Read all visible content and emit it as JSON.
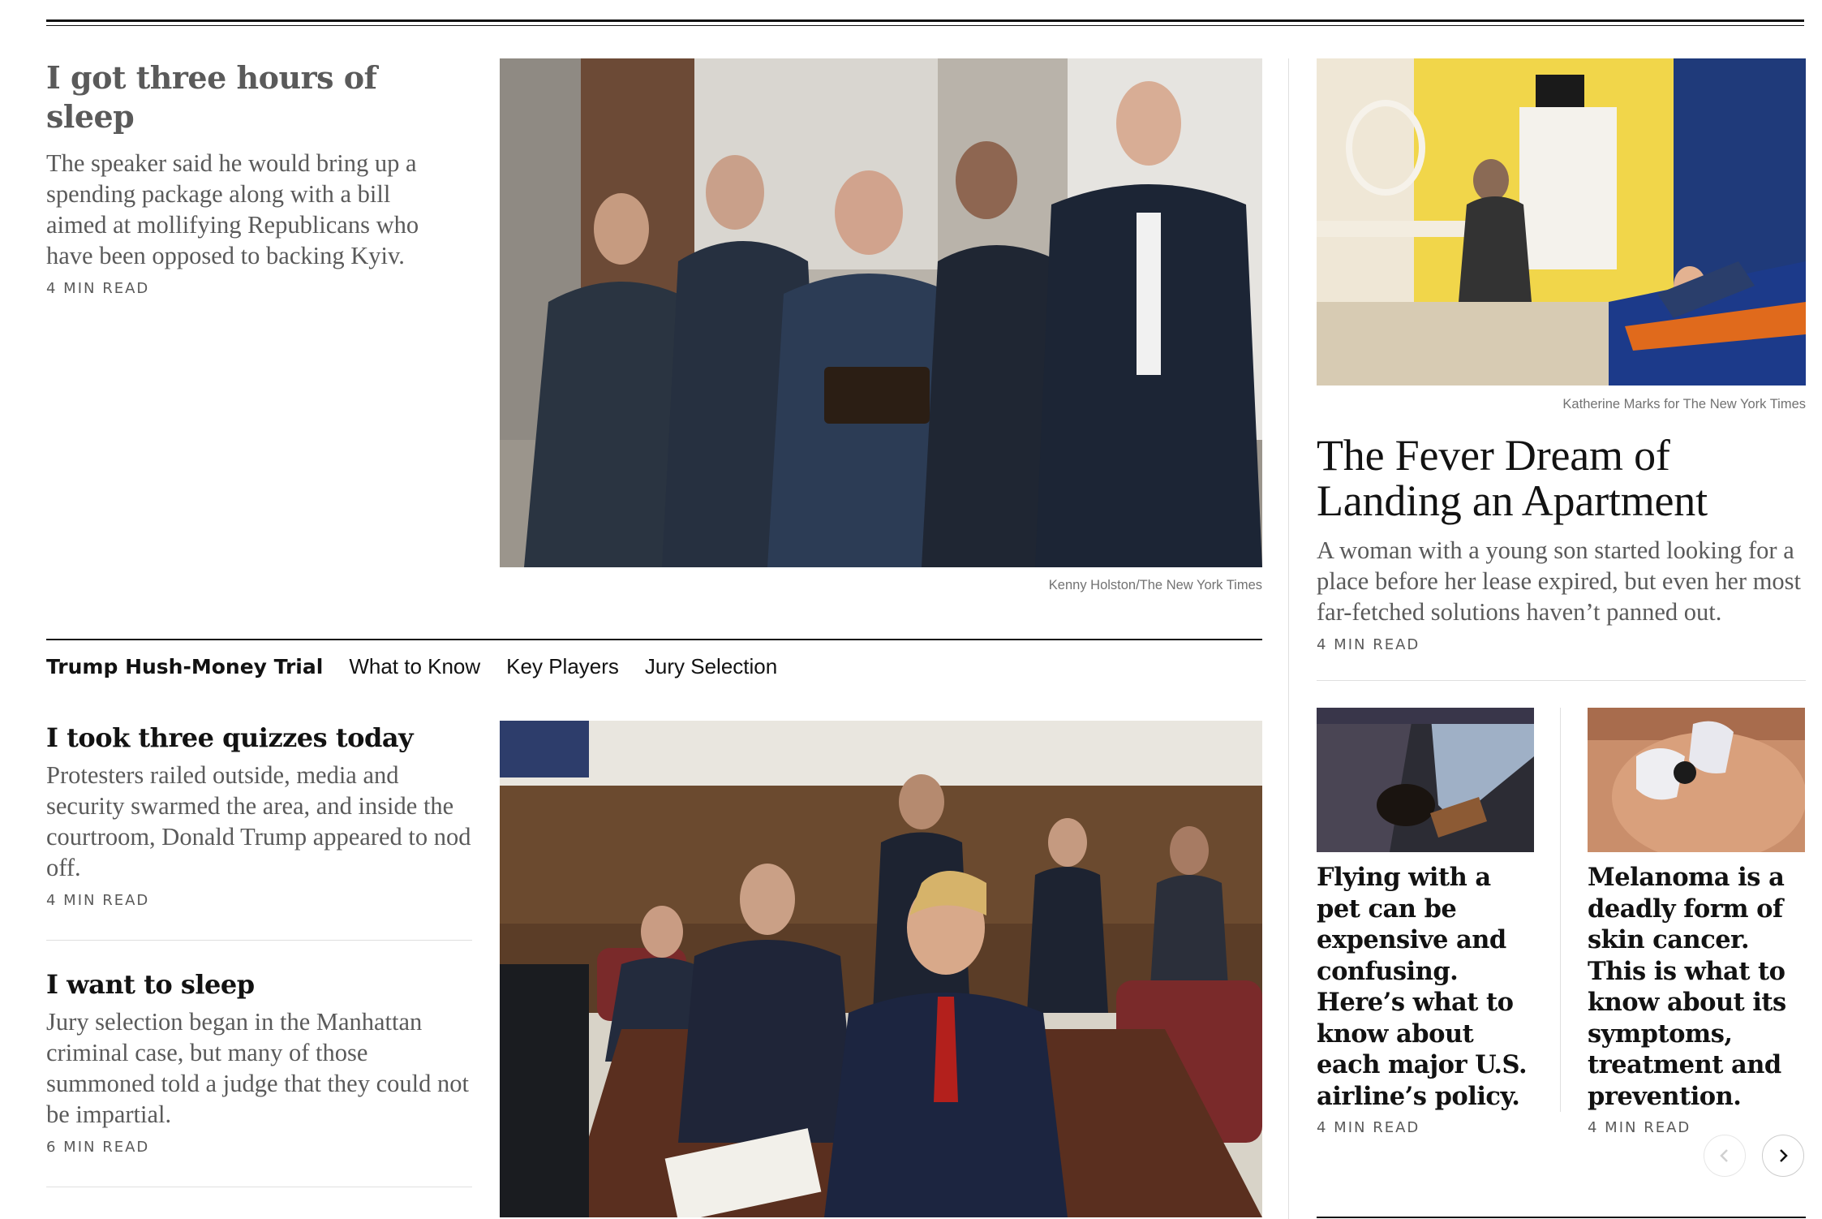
{
  "lead": {
    "headline": "I got three hours of sleep",
    "summary": "The speaker said he would bring up a spending package along with a bill aimed at mollifying Republicans who have been opposed to backing Kyiv.",
    "read_time": "4 MIN READ",
    "photo_credit": "Kenny Holston/The New York Times"
  },
  "section_nav": {
    "title": "Trump Hush-Money Trial",
    "links": [
      "What to Know",
      "Key Players",
      "Jury Selection"
    ]
  },
  "stories": [
    {
      "headline": "I took three quizzes today",
      "summary": "Protesters railed outside, media and security swarmed the area, and inside the courtroom, Donald Trump appeared to nod off.",
      "read_time": "4 MIN READ"
    },
    {
      "headline": "I want to sleep",
      "summary": "Jury selection began in the Manhattan criminal case, but many of those summoned told a judge that they could not be impartial.",
      "read_time": "6 MIN READ"
    }
  ],
  "feature": {
    "photo_credit": "Katherine Marks for The New York Times",
    "headline": "The Fever Dream of Landing an Apartment",
    "summary": "A woman with a young son started looking for a place before her lease expired, but even her most far-fetched solutions haven’t panned out.",
    "read_time": "4 MIN READ"
  },
  "carousel": {
    "cards": [
      {
        "headline": "Flying with a pet can be expensive and confusing. Here’s what to know about each major U.S. airline’s policy.",
        "read_time": "4 MIN READ",
        "icon": "pet-carrier-photo"
      },
      {
        "headline": "Melanoma is a deadly form of skin cancer. This is what to know about its symptoms, treatment and prevention.",
        "read_time": "4 MIN READ",
        "icon": "skin-exam-photo"
      }
    ],
    "prev_icon": "chevron-left-icon",
    "next_icon": "chevron-right-icon"
  }
}
